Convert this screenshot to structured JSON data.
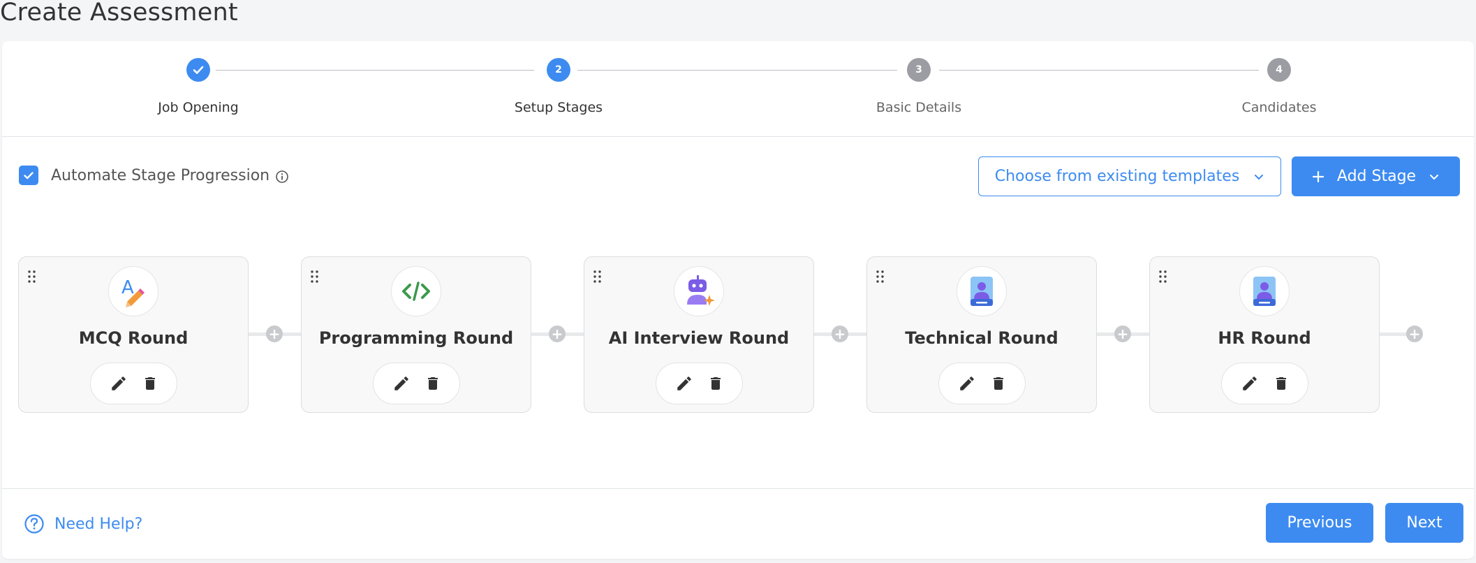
{
  "page": {
    "title": "Create Assessment"
  },
  "stepper": {
    "steps": [
      {
        "number": "1",
        "label": "Job Opening",
        "state": "completed"
      },
      {
        "number": "2",
        "label": "Setup Stages",
        "state": "active"
      },
      {
        "number": "3",
        "label": "Basic Details",
        "state": "pending"
      },
      {
        "number": "4",
        "label": "Candidates",
        "state": "pending"
      }
    ]
  },
  "controls": {
    "automate_label": "Automate Stage Progression",
    "automate_checked": true,
    "templates_label": "Choose from existing templates",
    "add_stage_label": "Add Stage"
  },
  "stages": [
    {
      "name": "MCQ Round",
      "icon": "mcq-pencil-icon"
    },
    {
      "name": "Programming Round",
      "icon": "code-brackets-icon"
    },
    {
      "name": "AI Interview Round",
      "icon": "ai-robot-icon"
    },
    {
      "name": "Technical Round",
      "icon": "person-id-card-icon"
    },
    {
      "name": "HR Round",
      "icon": "person-id-card-icon"
    }
  ],
  "footer": {
    "help_label": "Need Help?",
    "previous_label": "Previous",
    "next_label": "Next"
  },
  "colors": {
    "accent": "#3d8bf0",
    "pending_step": "#9b9da3"
  }
}
